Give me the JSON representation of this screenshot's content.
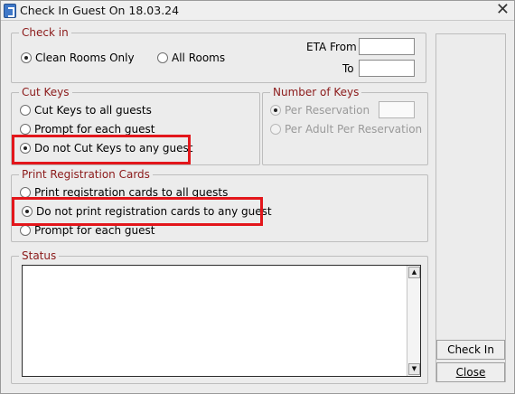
{
  "window": {
    "title": "Check In Guest On 18.03.24"
  },
  "checkin": {
    "legend": "Check in",
    "clean_rooms_label": "Clean Rooms Only",
    "all_rooms_label": "All Rooms",
    "selected": "clean_rooms",
    "eta_from_label": "ETA From",
    "eta_from_value": "",
    "to_label": "To",
    "to_value": ""
  },
  "cut_keys": {
    "legend": "Cut Keys",
    "options": [
      "Cut Keys to all guests",
      "Prompt for each guest",
      "Do not Cut Keys to any guest"
    ],
    "selected_index": 2
  },
  "number_of_keys": {
    "legend": "Number of Keys",
    "per_reservation_label": "Per Reservation",
    "per_reservation_value": "",
    "per_adult_label": "Per Adult Per Reservation",
    "enabled": false
  },
  "print_cards": {
    "legend": "Print Registration Cards",
    "options": [
      "Print registration cards to all guests",
      "Do not print registration cards to any guest",
      "Prompt for each guest"
    ],
    "selected_index": 1
  },
  "status": {
    "legend": "Status",
    "text": ""
  },
  "buttons": {
    "check_in": "Check In",
    "close": "Close"
  },
  "colors": {
    "legend_text": "#8b1a1a",
    "highlight_box": "#e3161b"
  },
  "icons": [
    "app-icon",
    "close-icon",
    "scroll-up-icon",
    "scroll-down-icon"
  ]
}
